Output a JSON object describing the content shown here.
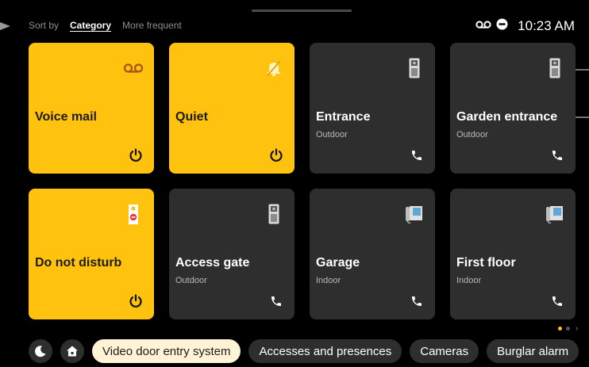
{
  "sort": {
    "label": "Sort by",
    "options": [
      "Category",
      "More frequent"
    ],
    "selected": "Category"
  },
  "status": {
    "time": "10:23 AM",
    "icons": [
      "voicemail-icon",
      "do-not-disturb-icon"
    ]
  },
  "tiles": [
    {
      "title": "Voice mail",
      "subtitle": "",
      "style": "yellow",
      "icon": "voicemail-icon",
      "action": "power-icon"
    },
    {
      "title": "Quiet",
      "subtitle": "",
      "style": "yellow",
      "icon": "bell-off-icon",
      "action": "power-icon"
    },
    {
      "title": "Entrance",
      "subtitle": "Outdoor",
      "style": "dark",
      "icon": "door-panel-icon",
      "action": "phone-icon"
    },
    {
      "title": "Garden entrance",
      "subtitle": "Outdoor",
      "style": "dark",
      "icon": "door-panel-icon",
      "action": "phone-icon"
    },
    {
      "title": "Do not disturb",
      "subtitle": "",
      "style": "yellow",
      "icon": "door-hanger-icon",
      "action": "power-icon"
    },
    {
      "title": "Access gate",
      "subtitle": "Outdoor",
      "style": "dark",
      "icon": "door-panel-icon",
      "action": "phone-icon"
    },
    {
      "title": "Garage",
      "subtitle": "Indoor",
      "style": "dark",
      "icon": "intercom-icon",
      "action": "phone-icon"
    },
    {
      "title": "First floor",
      "subtitle": "Indoor",
      "style": "dark",
      "icon": "intercom-icon",
      "action": "phone-icon"
    }
  ],
  "bottom": {
    "round_buttons": [
      "moon-icon",
      "home-icon"
    ],
    "chips": [
      "Video door entry system",
      "Accesses and presences",
      "Cameras",
      "Burglar alarm"
    ],
    "active_chip": "Video door entry system"
  },
  "pager": {
    "pages": 2,
    "current": 1
  },
  "colors": {
    "accent": "#ffc20e",
    "tile_dark": "#2e2e2e",
    "background": "#000000",
    "chip_active": "#fff3d6"
  }
}
